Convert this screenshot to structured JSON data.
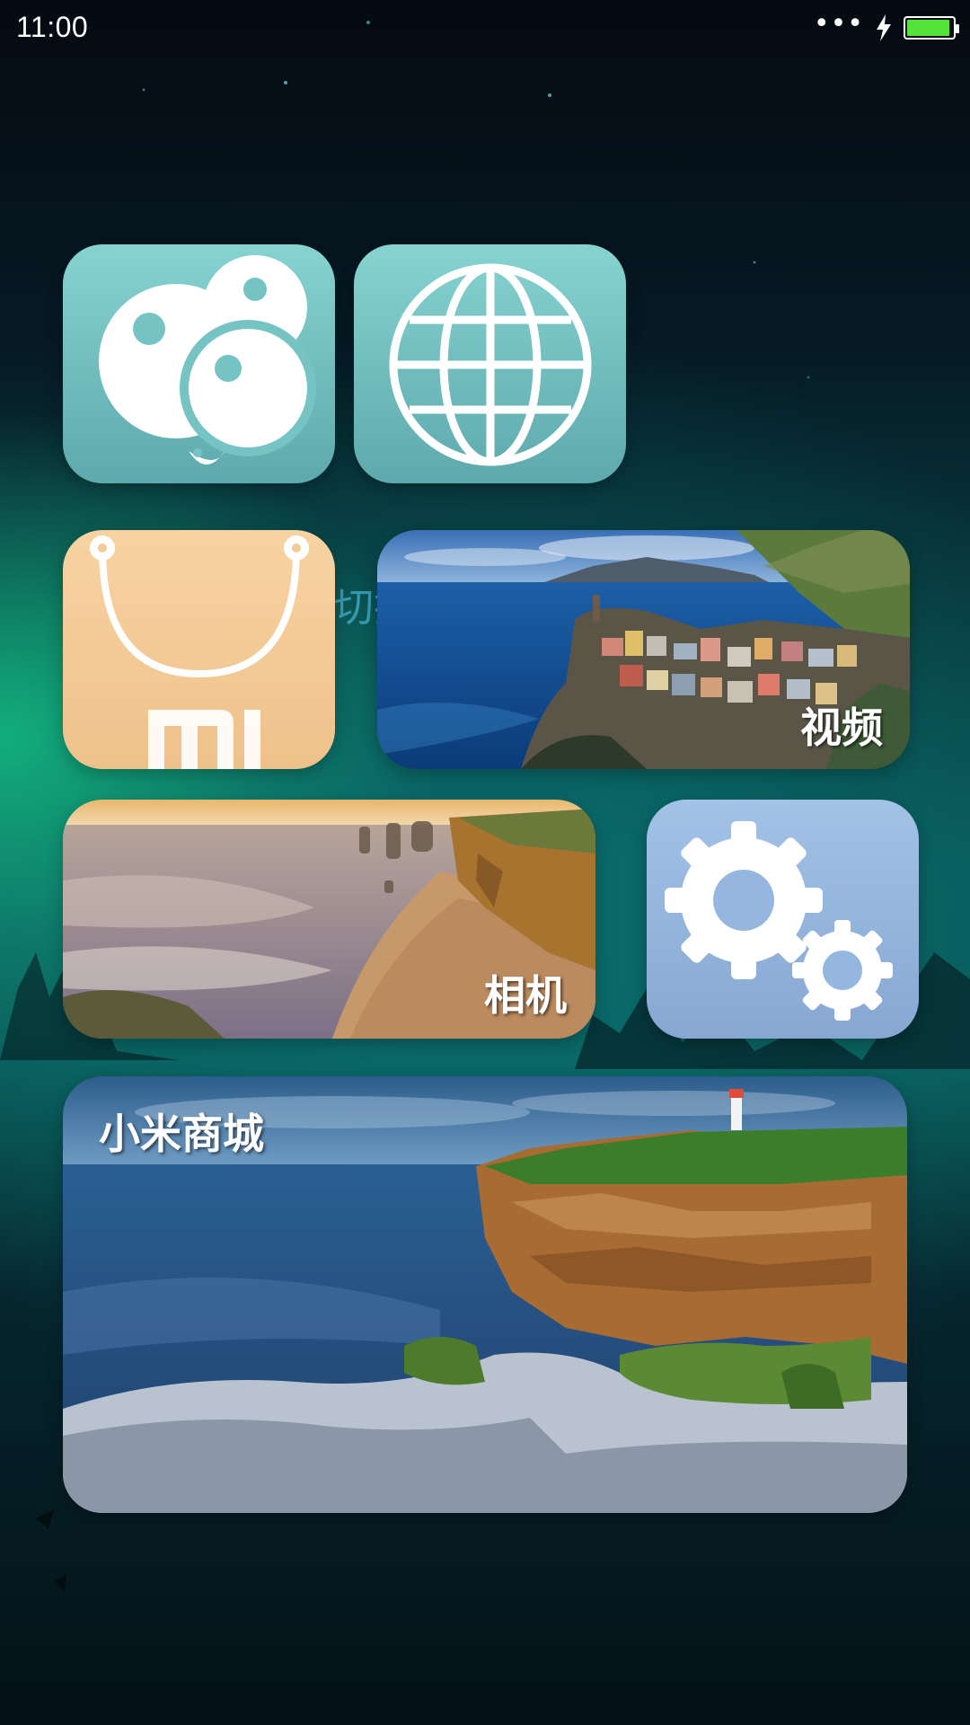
{
  "status_bar": {
    "time": "11:00",
    "signal_dots": "•••",
    "battery_color": "#55e43a",
    "battery_level": 0.95
  },
  "home": {
    "background_text": "切换",
    "tiles": {
      "bubbles_app": {
        "icon": "bubbles-icon",
        "color": "#75c4c3"
      },
      "browser_app": {
        "icon": "globe-icon",
        "color": "#75c4c3"
      },
      "mi_store_app": {
        "icon": "shopping-bag-mi-icon",
        "color": "#f3cb97"
      },
      "video_tile": {
        "label": "视频"
      },
      "camera_tile": {
        "label": "相机"
      },
      "settings_app": {
        "icon": "gears-icon",
        "color": "#94b6df"
      },
      "mi_mall_tile": {
        "label": "小米商城"
      }
    }
  }
}
